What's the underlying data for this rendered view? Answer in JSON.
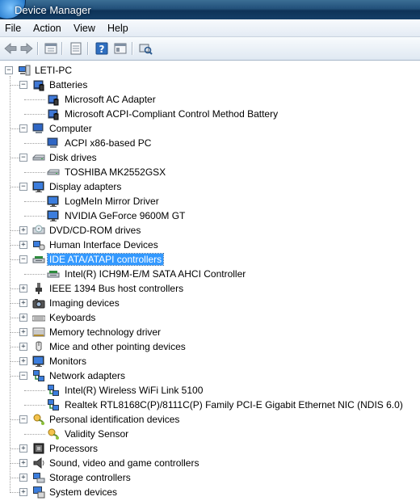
{
  "window": {
    "title": "Device Manager"
  },
  "menu": [
    "File",
    "Action",
    "View",
    "Help"
  ],
  "toolbar": {
    "buttons": [
      "back-icon",
      "forward-icon",
      "properties-icon",
      "show-hide-tree-icon",
      "help-icon",
      "console-icon",
      "scan-hardware-icon"
    ]
  },
  "tree": {
    "root": "LETI-PC",
    "categories": [
      {
        "label": "Batteries",
        "icon": "battery-icon",
        "expanded": true,
        "children": [
          {
            "label": "Microsoft AC Adapter",
            "icon": "battery-icon"
          },
          {
            "label": "Microsoft ACPI-Compliant Control Method Battery",
            "icon": "battery-icon"
          }
        ]
      },
      {
        "label": "Computer",
        "icon": "computer-icon",
        "expanded": true,
        "children": [
          {
            "label": "ACPI x86-based PC",
            "icon": "computer-icon"
          }
        ]
      },
      {
        "label": "Disk drives",
        "icon": "disk-drive-icon",
        "expanded": true,
        "children": [
          {
            "label": "TOSHIBA MK2552GSX",
            "icon": "disk-drive-icon"
          }
        ]
      },
      {
        "label": "Display adapters",
        "icon": "monitor-icon",
        "expanded": true,
        "children": [
          {
            "label": "LogMeIn Mirror Driver",
            "icon": "monitor-icon"
          },
          {
            "label": "NVIDIA GeForce 9600M GT",
            "icon": "monitor-icon"
          }
        ]
      },
      {
        "label": "DVD/CD-ROM drives",
        "icon": "dvd-drive-icon",
        "expanded": false,
        "children": []
      },
      {
        "label": "Human Interface Devices",
        "icon": "hid-icon",
        "expanded": false,
        "children": []
      },
      {
        "label": "IDE ATA/ATAPI controllers",
        "icon": "ide-controller-icon",
        "expanded": true,
        "selected": true,
        "children": [
          {
            "label": "Intel(R) ICH9M-E/M SATA AHCI Controller",
            "icon": "ide-controller-icon"
          }
        ]
      },
      {
        "label": "IEEE 1394 Bus host controllers",
        "icon": "ieee1394-icon",
        "expanded": false,
        "children": []
      },
      {
        "label": "Imaging devices",
        "icon": "camera-icon",
        "expanded": false,
        "children": []
      },
      {
        "label": "Keyboards",
        "icon": "keyboard-icon",
        "expanded": false,
        "children": []
      },
      {
        "label": "Memory technology driver",
        "icon": "memory-icon",
        "expanded": false,
        "children": []
      },
      {
        "label": "Mice and other pointing devices",
        "icon": "mouse-icon",
        "expanded": false,
        "children": []
      },
      {
        "label": "Monitors",
        "icon": "monitor-icon",
        "expanded": false,
        "children": []
      },
      {
        "label": "Network adapters",
        "icon": "network-icon",
        "expanded": true,
        "children": [
          {
            "label": "Intel(R) Wireless WiFi Link 5100",
            "icon": "network-icon"
          },
          {
            "label": "Realtek RTL8168C(P)/8111C(P) Family PCI-E Gigabit Ethernet NIC (NDIS 6.0)",
            "icon": "network-icon"
          }
        ]
      },
      {
        "label": "Personal identification devices",
        "icon": "fingerprint-icon",
        "expanded": true,
        "children": [
          {
            "label": "Validity Sensor",
            "icon": "fingerprint-icon"
          }
        ]
      },
      {
        "label": "Processors",
        "icon": "processor-icon",
        "expanded": false,
        "children": []
      },
      {
        "label": "Sound, video and game controllers",
        "icon": "speaker-icon",
        "expanded": false,
        "children": []
      },
      {
        "label": "Storage controllers",
        "icon": "storage-controller-icon",
        "expanded": false,
        "children": []
      },
      {
        "label": "System devices",
        "icon": "system-device-icon",
        "expanded": false,
        "children": []
      }
    ]
  }
}
